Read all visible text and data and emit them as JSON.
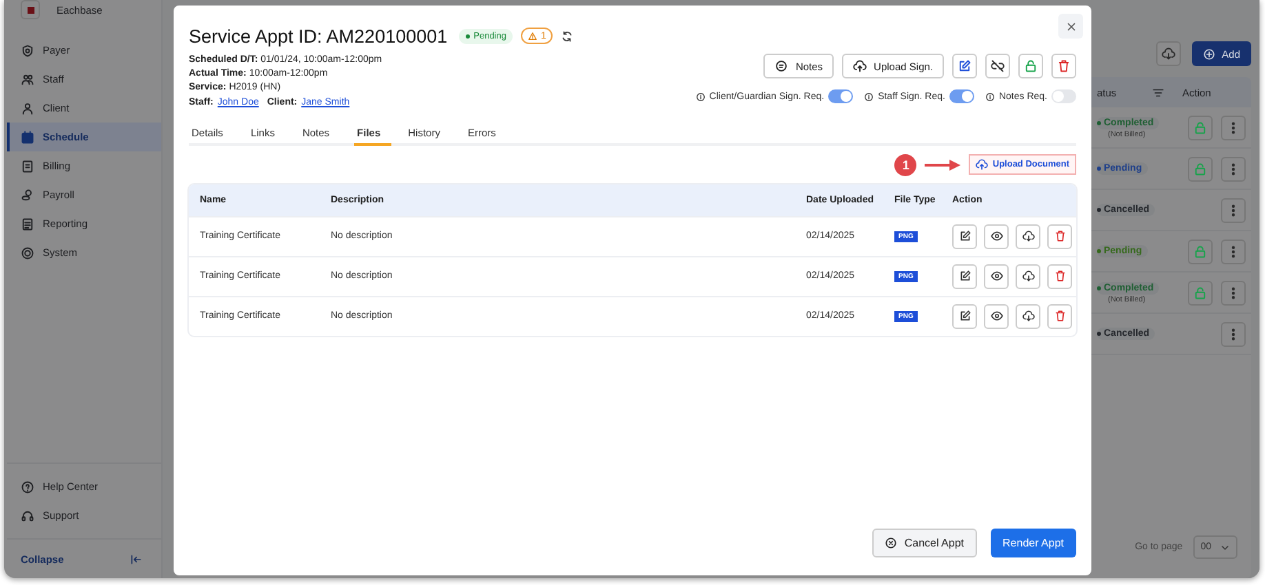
{
  "app": {
    "brand": "Eachbase",
    "nav": [
      {
        "label": "Payer",
        "selected": false
      },
      {
        "label": "Staff",
        "selected": false
      },
      {
        "label": "Client",
        "selected": false
      },
      {
        "label": "Schedule",
        "selected": true
      },
      {
        "label": "Billing",
        "selected": false
      },
      {
        "label": "Payroll",
        "selected": false
      },
      {
        "label": "Reporting",
        "selected": false
      },
      {
        "label": "System",
        "selected": false
      }
    ],
    "footer_nav": [
      "Help Center",
      "Support"
    ],
    "collapse": "Collapse",
    "add_button": "Add",
    "table": {
      "columns": [
        "atus",
        "Action"
      ],
      "rows": [
        {
          "status": "Completed",
          "color": "#1f5f33",
          "note": "(Not Billed)",
          "lock": true
        },
        {
          "status": "Pending",
          "color": "#1e3f8a",
          "lock": true
        },
        {
          "status": "Cancelled",
          "color": "#26292e",
          "lock": false
        },
        {
          "status": "Pending",
          "color": "#36691c",
          "lock": true
        },
        {
          "status": "Completed",
          "color": "#1f5f33",
          "note": "(Not Billed)",
          "lock": true
        },
        {
          "status": "Cancelled",
          "color": "#26292e",
          "lock": false
        }
      ]
    },
    "go_to_page": "Go to page",
    "page_select": "00"
  },
  "modal": {
    "title": "Service Appt ID: AM220100001",
    "status": "Pending",
    "warning_count": "1",
    "info": [
      "**Scheduled D/T:** 01/01/24, 10:00am-12:00pm",
      "**Actual Time:** 10:00am-12:00pm",
      "**Service:** H2019 (HN)"
    ],
    "staff_label": "Staff:",
    "staff": "John Doe",
    "client_label": "Client:",
    "client": "Jane Smith",
    "buttons": [
      "Notes",
      "Upload Sign."
    ],
    "icon_buttons": [
      {
        "kind": "edit"
      },
      {
        "kind": "unlink"
      },
      {
        "kind": "unlock"
      },
      {
        "kind": "delete"
      }
    ],
    "toggles": [
      {
        "label": "Client/Guardian Sign. Req.",
        "on": true
      },
      {
        "label": "Staff Sign. Req.",
        "on": true
      },
      {
        "label": "Notes Req.",
        "on": false
      }
    ],
    "tabs": [
      {
        "label": "Details",
        "selected": false
      },
      {
        "label": "Links",
        "selected": false
      },
      {
        "label": "Notes",
        "selected": false
      },
      {
        "label": "Files",
        "selected": true
      },
      {
        "label": "History",
        "selected": false
      },
      {
        "label": "Errors",
        "selected": false
      }
    ],
    "callout": "1",
    "upload_button": "Upload Document",
    "files": {
      "columns": [
        "Name",
        "Description",
        "Date Uploaded",
        "File Type",
        "Action"
      ],
      "rows": [
        {
          "name": "Training Certificate",
          "description": "No description",
          "date": "02/14/2025",
          "file_type": "PNG"
        },
        {
          "name": "Training Certificate",
          "description": "No description",
          "date": "02/14/2025",
          "file_type": "PNG"
        },
        {
          "name": "Training Certificate",
          "description": "No description",
          "date": "02/14/2025",
          "file_type": "PNG"
        }
      ]
    },
    "cancel_button": "Cancel Appt",
    "render_button": "Render Appt"
  }
}
